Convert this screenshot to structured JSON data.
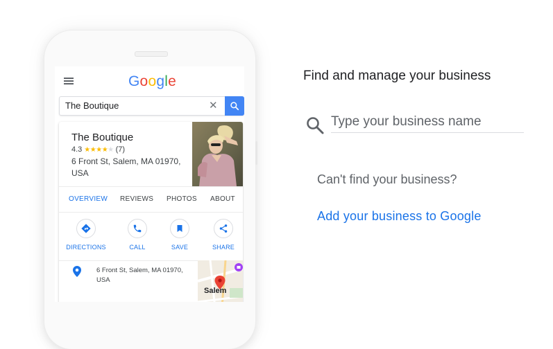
{
  "phone": {
    "logo": [
      "G",
      "o",
      "o",
      "g",
      "l",
      "e"
    ],
    "logo_colors": [
      "#4285f4",
      "#ea4335",
      "#fbbc05",
      "#4285f4",
      "#34a853",
      "#ea4335"
    ],
    "search_value": "The Boutique",
    "clear_glyph": "✕",
    "business": {
      "name": "The Boutique",
      "rating": "4.3",
      "stars": "★★★★",
      "stars_off": "★",
      "review_count": "(7)",
      "address_line1": "6 Front St, Salem, MA 01970,",
      "address_line2": "USA"
    },
    "tabs": [
      {
        "label": "OVERVIEW",
        "active": true
      },
      {
        "label": "REVIEWS",
        "active": false
      },
      {
        "label": "PHOTOS",
        "active": false
      },
      {
        "label": "ABOUT",
        "active": false
      }
    ],
    "actions": [
      {
        "label": "DIRECTIONS",
        "icon": "directions-icon"
      },
      {
        "label": "CALL",
        "icon": "phone-icon"
      },
      {
        "label": "SAVE",
        "icon": "bookmark-icon"
      },
      {
        "label": "SHARE",
        "icon": "share-icon"
      }
    ],
    "bottom_address_line1": "6 Front St, Salem, MA 01970,",
    "bottom_address_line2": "USA",
    "map_label": "Salem"
  },
  "panel": {
    "title": "Find and manage your business",
    "input_placeholder": "Type your business name",
    "cant_find": "Can't find your business?",
    "add_link": "Add your business to Google"
  },
  "colors": {
    "accent": "#1a73e8",
    "search_button": "#4285f4",
    "star": "#fbbc04",
    "map_pin": "#ea4335"
  }
}
